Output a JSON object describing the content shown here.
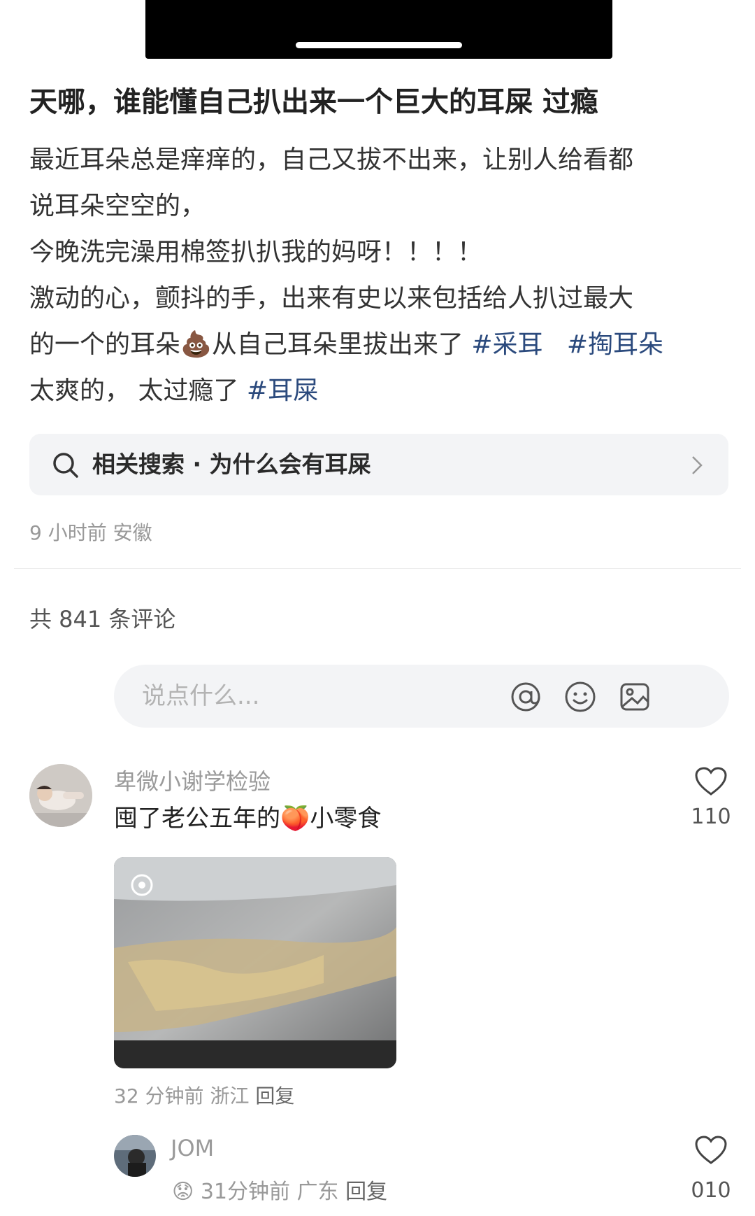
{
  "post": {
    "title": "天哪，谁能懂自己扒出来一个巨大的耳屎 过瘾",
    "lines": [
      "最近耳朵总是痒痒的，自己又拔不出来，让别人给看都",
      "说耳朵空空的，",
      "今晚洗完澡用棉签扒扒我的妈呀！！！！",
      "激动的心，颤抖的手，出来有史以来包括给人扒过最大"
    ],
    "line5_prefix": "的一个的耳朵",
    "line5_emoji": "💩",
    "line5_suffix": "从自己耳朵里拔出来了",
    "tag1": "#采耳",
    "tag2": "#掏耳朵",
    "line6_prefix": "太爽的， 太过瘾了",
    "tag3": "#耳屎",
    "related_search": "相关搜索 · 为什么会有耳屎",
    "meta": "9 小时前 安徽"
  },
  "comments_header": "共 841 条评论",
  "comment_input": {
    "placeholder": "说点什么..."
  },
  "comments": [
    {
      "user": "卑微小谢学检验",
      "text_prefix": "囤了老公五年的",
      "text_emoji": "🍑",
      "text_suffix": "小零食",
      "likes": "110",
      "time": "32 分钟前",
      "location": "浙江",
      "reply": "回复"
    },
    {
      "user": "JOM",
      "emoji": "😟",
      "time": "31分钟前",
      "location": "广东",
      "reply": "回复",
      "likes": "010"
    }
  ],
  "colors": {
    "tag": "#2b4a7d",
    "muted": "#999999",
    "input_bg": "#f3f4f6"
  }
}
